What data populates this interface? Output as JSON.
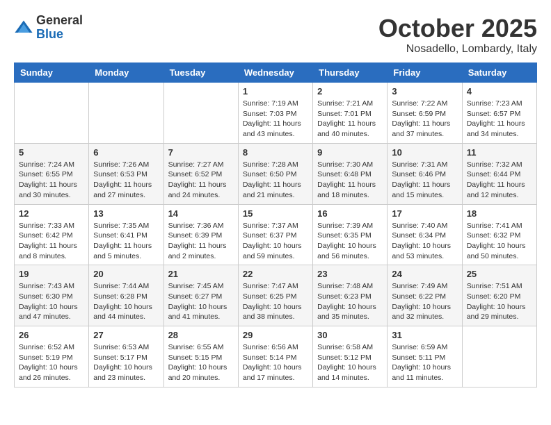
{
  "logo": {
    "general": "General",
    "blue": "Blue"
  },
  "header": {
    "title": "October 2025",
    "subtitle": "Nosadello, Lombardy, Italy"
  },
  "weekdays": [
    "Sunday",
    "Monday",
    "Tuesday",
    "Wednesday",
    "Thursday",
    "Friday",
    "Saturday"
  ],
  "weeks": [
    [
      {
        "day": "",
        "info": ""
      },
      {
        "day": "",
        "info": ""
      },
      {
        "day": "",
        "info": ""
      },
      {
        "day": "1",
        "info": "Sunrise: 7:19 AM\nSunset: 7:03 PM\nDaylight: 11 hours\nand 43 minutes."
      },
      {
        "day": "2",
        "info": "Sunrise: 7:21 AM\nSunset: 7:01 PM\nDaylight: 11 hours\nand 40 minutes."
      },
      {
        "day": "3",
        "info": "Sunrise: 7:22 AM\nSunset: 6:59 PM\nDaylight: 11 hours\nand 37 minutes."
      },
      {
        "day": "4",
        "info": "Sunrise: 7:23 AM\nSunset: 6:57 PM\nDaylight: 11 hours\nand 34 minutes."
      }
    ],
    [
      {
        "day": "5",
        "info": "Sunrise: 7:24 AM\nSunset: 6:55 PM\nDaylight: 11 hours\nand 30 minutes."
      },
      {
        "day": "6",
        "info": "Sunrise: 7:26 AM\nSunset: 6:53 PM\nDaylight: 11 hours\nand 27 minutes."
      },
      {
        "day": "7",
        "info": "Sunrise: 7:27 AM\nSunset: 6:52 PM\nDaylight: 11 hours\nand 24 minutes."
      },
      {
        "day": "8",
        "info": "Sunrise: 7:28 AM\nSunset: 6:50 PM\nDaylight: 11 hours\nand 21 minutes."
      },
      {
        "day": "9",
        "info": "Sunrise: 7:30 AM\nSunset: 6:48 PM\nDaylight: 11 hours\nand 18 minutes."
      },
      {
        "day": "10",
        "info": "Sunrise: 7:31 AM\nSunset: 6:46 PM\nDaylight: 11 hours\nand 15 minutes."
      },
      {
        "day": "11",
        "info": "Sunrise: 7:32 AM\nSunset: 6:44 PM\nDaylight: 11 hours\nand 12 minutes."
      }
    ],
    [
      {
        "day": "12",
        "info": "Sunrise: 7:33 AM\nSunset: 6:42 PM\nDaylight: 11 hours\nand 8 minutes."
      },
      {
        "day": "13",
        "info": "Sunrise: 7:35 AM\nSunset: 6:41 PM\nDaylight: 11 hours\nand 5 minutes."
      },
      {
        "day": "14",
        "info": "Sunrise: 7:36 AM\nSunset: 6:39 PM\nDaylight: 11 hours\nand 2 minutes."
      },
      {
        "day": "15",
        "info": "Sunrise: 7:37 AM\nSunset: 6:37 PM\nDaylight: 10 hours\nand 59 minutes."
      },
      {
        "day": "16",
        "info": "Sunrise: 7:39 AM\nSunset: 6:35 PM\nDaylight: 10 hours\nand 56 minutes."
      },
      {
        "day": "17",
        "info": "Sunrise: 7:40 AM\nSunset: 6:34 PM\nDaylight: 10 hours\nand 53 minutes."
      },
      {
        "day": "18",
        "info": "Sunrise: 7:41 AM\nSunset: 6:32 PM\nDaylight: 10 hours\nand 50 minutes."
      }
    ],
    [
      {
        "day": "19",
        "info": "Sunrise: 7:43 AM\nSunset: 6:30 PM\nDaylight: 10 hours\nand 47 minutes."
      },
      {
        "day": "20",
        "info": "Sunrise: 7:44 AM\nSunset: 6:28 PM\nDaylight: 10 hours\nand 44 minutes."
      },
      {
        "day": "21",
        "info": "Sunrise: 7:45 AM\nSunset: 6:27 PM\nDaylight: 10 hours\nand 41 minutes."
      },
      {
        "day": "22",
        "info": "Sunrise: 7:47 AM\nSunset: 6:25 PM\nDaylight: 10 hours\nand 38 minutes."
      },
      {
        "day": "23",
        "info": "Sunrise: 7:48 AM\nSunset: 6:23 PM\nDaylight: 10 hours\nand 35 minutes."
      },
      {
        "day": "24",
        "info": "Sunrise: 7:49 AM\nSunset: 6:22 PM\nDaylight: 10 hours\nand 32 minutes."
      },
      {
        "day": "25",
        "info": "Sunrise: 7:51 AM\nSunset: 6:20 PM\nDaylight: 10 hours\nand 29 minutes."
      }
    ],
    [
      {
        "day": "26",
        "info": "Sunrise: 6:52 AM\nSunset: 5:19 PM\nDaylight: 10 hours\nand 26 minutes."
      },
      {
        "day": "27",
        "info": "Sunrise: 6:53 AM\nSunset: 5:17 PM\nDaylight: 10 hours\nand 23 minutes."
      },
      {
        "day": "28",
        "info": "Sunrise: 6:55 AM\nSunset: 5:15 PM\nDaylight: 10 hours\nand 20 minutes."
      },
      {
        "day": "29",
        "info": "Sunrise: 6:56 AM\nSunset: 5:14 PM\nDaylight: 10 hours\nand 17 minutes."
      },
      {
        "day": "30",
        "info": "Sunrise: 6:58 AM\nSunset: 5:12 PM\nDaylight: 10 hours\nand 14 minutes."
      },
      {
        "day": "31",
        "info": "Sunrise: 6:59 AM\nSunset: 5:11 PM\nDaylight: 10 hours\nand 11 minutes."
      },
      {
        "day": "",
        "info": ""
      }
    ]
  ]
}
